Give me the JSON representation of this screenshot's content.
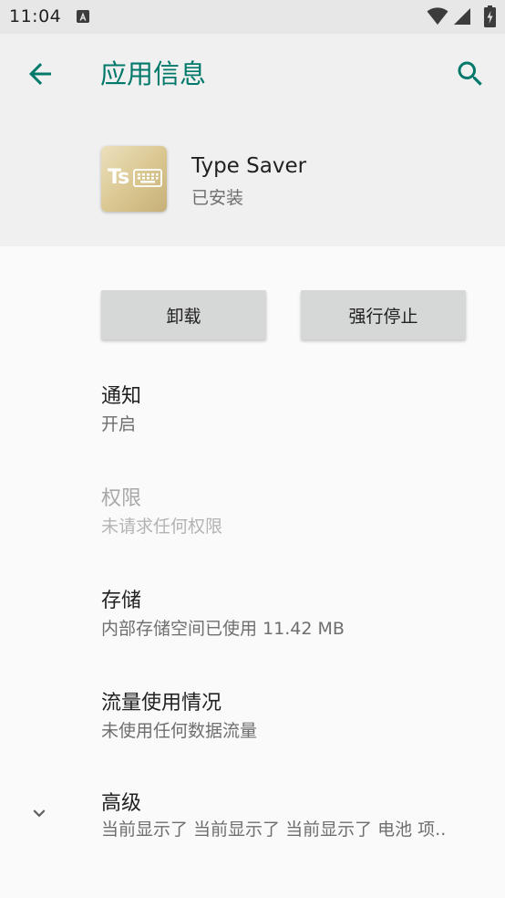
{
  "status_bar": {
    "time": "11:04",
    "notification_icon": "a-box-icon",
    "wifi_icon": "wifi-icon",
    "signal_icon": "cell-signal-icon",
    "battery_icon": "battery-charging-icon"
  },
  "toolbar": {
    "title": "应用信息",
    "back_icon": "arrow-back-icon",
    "search_icon": "search-icon"
  },
  "app": {
    "icon_text": "Ts",
    "name": "Type Saver",
    "status": "已安装"
  },
  "buttons": {
    "uninstall": "卸载",
    "force_stop": "强行停止"
  },
  "preferences": [
    {
      "title": "通知",
      "summary": "开启",
      "enabled": true
    },
    {
      "title": "权限",
      "summary": "未请求任何权限",
      "enabled": false
    },
    {
      "title": "存储",
      "summary": "内部存储空间已使用 11.42 MB",
      "enabled": true
    },
    {
      "title": "流量使用情况",
      "summary": "未使用任何数据流量",
      "enabled": true
    }
  ],
  "advanced": {
    "title": "高级",
    "summary": "当前显示了 当前显示了 当前显示了 电池 项..",
    "chevron_icon": "chevron-down-icon"
  },
  "colors": {
    "accent": "#00796b",
    "header_bg": "#f0f0f0",
    "page_bg": "#fafafa",
    "button_bg": "#d6d7d7"
  }
}
